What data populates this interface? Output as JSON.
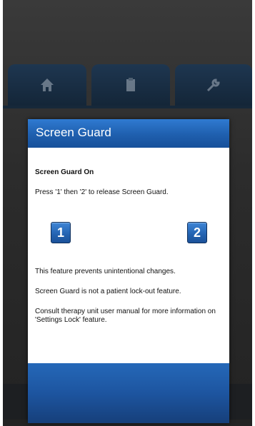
{
  "tabs": [
    {
      "icon": "home-icon"
    },
    {
      "icon": "clipboard-icon"
    },
    {
      "icon": "wrench-icon"
    }
  ],
  "dialog": {
    "title": "Screen Guard",
    "status": "Screen Guard On",
    "instruction": "Press '1' then '2' to release Screen Guard.",
    "button1_label": "1",
    "button2_label": "2",
    "notes": [
      "This feature prevents unintentional changes.",
      "Screen Guard is not a patient lock-out feature.",
      "Consult therapy unit user manual for more information on 'Settings Lock' feature."
    ]
  },
  "colors": {
    "accent_blue": "#2362b0",
    "header_blue": "#1f5fae",
    "dimmed_tab": "#1e3650",
    "background": "#2c2c2c"
  }
}
